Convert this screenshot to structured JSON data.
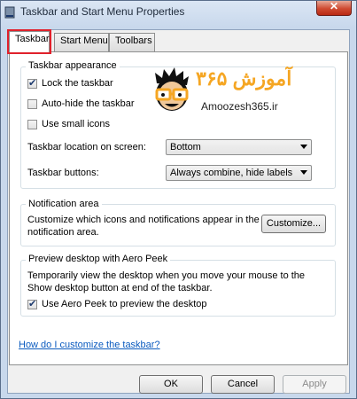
{
  "window": {
    "title": "Taskbar and Start Menu Properties",
    "close_glyph": "✕"
  },
  "tabs": [
    {
      "label": "Taskbar",
      "active": true
    },
    {
      "label": "Start Menu",
      "active": false
    },
    {
      "label": "Toolbars",
      "active": false
    }
  ],
  "taskbar_appearance": {
    "title": "Taskbar appearance",
    "lock_taskbar": {
      "label": "Lock the taskbar",
      "checked": true
    },
    "auto_hide": {
      "label": "Auto-hide the taskbar",
      "checked": false
    },
    "small_icons": {
      "label": "Use small icons",
      "checked": false
    },
    "location_label": "Taskbar location on screen:",
    "location_value": "Bottom",
    "buttons_label": "Taskbar buttons:",
    "buttons_value": "Always combine, hide labels"
  },
  "notification_area": {
    "title": "Notification area",
    "description_line1": "Customize which icons and notifications appear in the",
    "description_line2": "notification area.",
    "customize_label": "Customize..."
  },
  "aero_peek": {
    "title": "Preview desktop with Aero Peek",
    "description_line1": "Temporarily view the desktop when you move your mouse to the",
    "description_line2": "Show desktop button at end of the taskbar.",
    "use_aero_peek": {
      "label": "Use Aero Peek to preview the desktop",
      "checked": true
    }
  },
  "help_link": "How do I customize the taskbar?",
  "footer": {
    "ok": "OK",
    "cancel": "Cancel",
    "apply": "Apply"
  },
  "watermark": {
    "text_fa": "آموزش ۳۶۵",
    "site": "Amoozesh365.ir"
  },
  "colors": {
    "highlight": "#e0212b",
    "link": "#0b5bbf",
    "watermark_accent": "#f5a623"
  }
}
